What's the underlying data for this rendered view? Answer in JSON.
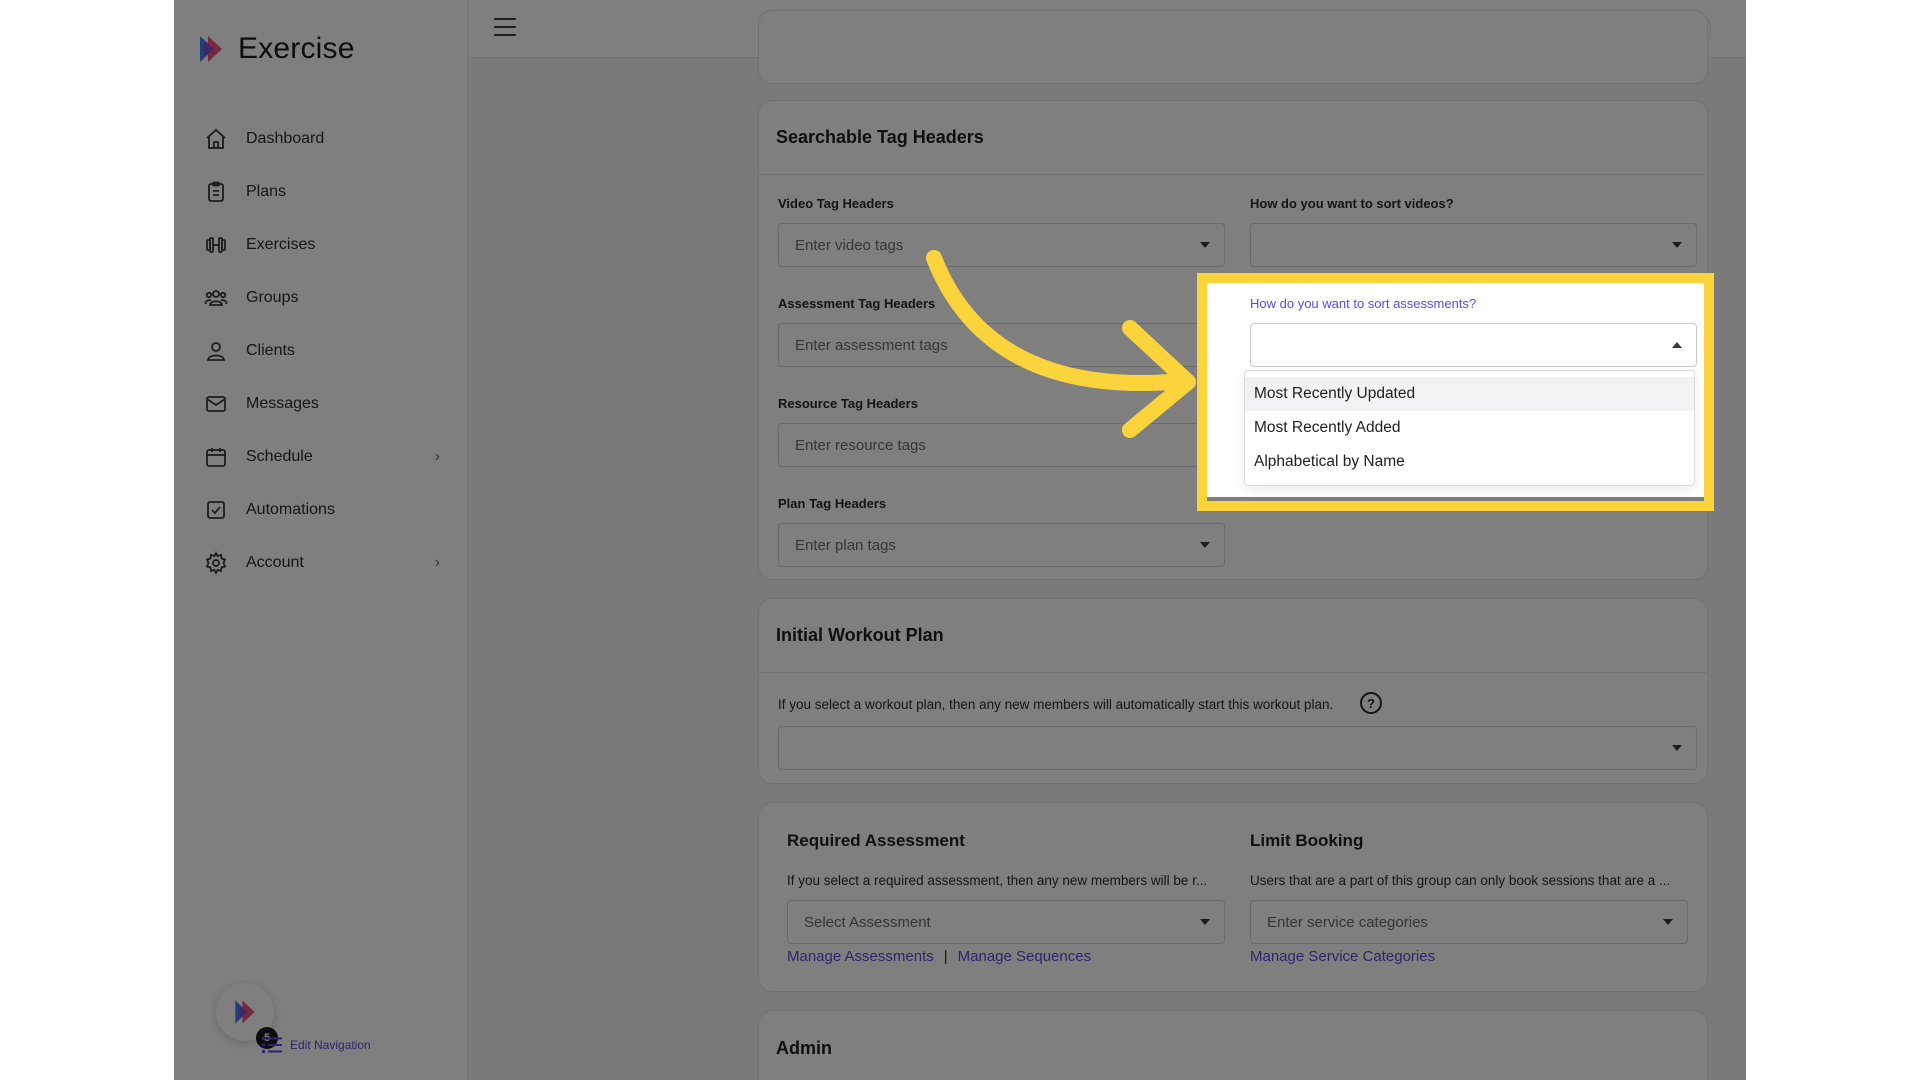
{
  "brand": {
    "name": "Exercise"
  },
  "sidebar": {
    "items": [
      {
        "label": "Dashboard",
        "icon": "home-icon"
      },
      {
        "label": "Plans",
        "icon": "clipboard-icon"
      },
      {
        "label": "Exercises",
        "icon": "dumbbell-icon"
      },
      {
        "label": "Groups",
        "icon": "users-icon"
      },
      {
        "label": "Clients",
        "icon": "user-icon"
      },
      {
        "label": "Messages",
        "icon": "mail-icon"
      },
      {
        "label": "Schedule",
        "icon": "calendar-icon",
        "has_submenu": true
      },
      {
        "label": "Automations",
        "icon": "checkbox-icon"
      },
      {
        "label": "Account",
        "icon": "gear-icon",
        "has_submenu": true
      }
    ],
    "badge_count": "5",
    "edit_nav_label": "Edit Navigation"
  },
  "header": {
    "icons": [
      "history-icon",
      "lightning-icon",
      "apps-grid-icon",
      "bell-icon",
      "avatar"
    ]
  },
  "tag_headers": {
    "title": "Searchable Tag Headers",
    "video_label": "Video Tag Headers",
    "video_placeholder": "Enter video tags",
    "sort_videos_label": "How do you want to sort videos?",
    "sort_videos_value": "",
    "assessment_label": "Assessment Tag Headers",
    "assessment_placeholder": "Enter assessment tags",
    "sort_assessments_label": "How do you want to sort assessments?",
    "sort_assessments_value": "",
    "resource_label": "Resource Tag Headers",
    "resource_placeholder": "Enter resource tags",
    "plan_label": "Plan Tag Headers",
    "plan_placeholder": "Enter plan tags"
  },
  "sort_menu": {
    "options": [
      "Most Recently Updated",
      "Most Recently Added",
      "Alphabetical by Name"
    ],
    "highlighted": "Most Recently Updated"
  },
  "workout_plan": {
    "title": "Initial Workout Plan",
    "description": "If you select a workout plan, then any new members will automatically start this workout plan.",
    "value": ""
  },
  "required_assessment": {
    "title": "Required Assessment",
    "description": "If you select a required assessment, then any new members will be r...",
    "placeholder": "Select Assessment",
    "link_manage_assessments": "Manage Assessments",
    "separator": "|",
    "link_manage_sequences": "Manage Sequences"
  },
  "limit_booking": {
    "title": "Limit Booking",
    "description": "Users that are a part of this group can only book sessions that are a ...",
    "placeholder": "Enter service categories",
    "link_manage": "Manage Service Categories"
  },
  "admin": {
    "title": "Admin"
  },
  "colors": {
    "accent": "#5b4bdc",
    "highlight": "#fbd43c",
    "dot": "#6b5ce7"
  }
}
